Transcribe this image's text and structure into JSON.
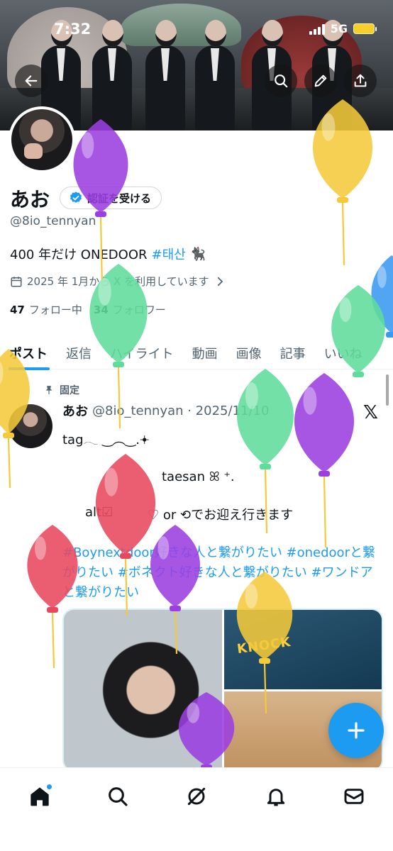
{
  "status_bar": {
    "time": "7:32",
    "network": "5G"
  },
  "header": {
    "icons": [
      "back-arrow-icon",
      "search-icon",
      "edit-pencil-icon",
      "share-icon"
    ]
  },
  "profile": {
    "display_name": "あお",
    "verify_button_label": "認証を受ける",
    "handle": "@8io_tennyan",
    "bio_text": "400 年だけ ONEDOOR",
    "bio_hashtag": "#태산",
    "bio_emoji": "🐈‍⬛",
    "joined": "2025 年 1月から X を利用しています",
    "following_count": "47",
    "following_label": "フォロー中",
    "followers_count": "34",
    "followers_label": "フォロワー"
  },
  "tabs": [
    {
      "label": "ポスト"
    },
    {
      "label": "返信"
    },
    {
      "label": "ハイライト"
    },
    {
      "label": "動画"
    },
    {
      "label": "画像"
    },
    {
      "label": "記事"
    },
    {
      "label": "いいね"
    }
  ],
  "post": {
    "pinned_label": "固定",
    "author_name": "あお",
    "meta": "@8io_tennyan · 2025/11/10",
    "line1": "tag𓂃 ‿︵‿.𖥔",
    "line2": "taesan ꕤ ⁺.",
    "line3": "alt☑",
    "line4": "♡ or ⟲でお迎え行きます",
    "hashtags": "#Boynextdoor好きな人と繋がりたい #onedoorと繋がりたい #ボネクト好きな人と繋がりたい #ワンドアと繋がりたい",
    "media_sign": "KNOCK"
  },
  "balloon_colors": {
    "purple": "#9b3fe0",
    "yellow": "#f4c93a",
    "green": "#5fdc9b",
    "red": "#e8485f",
    "blue": "#3a99f0"
  },
  "accent": "#1d9bf0"
}
